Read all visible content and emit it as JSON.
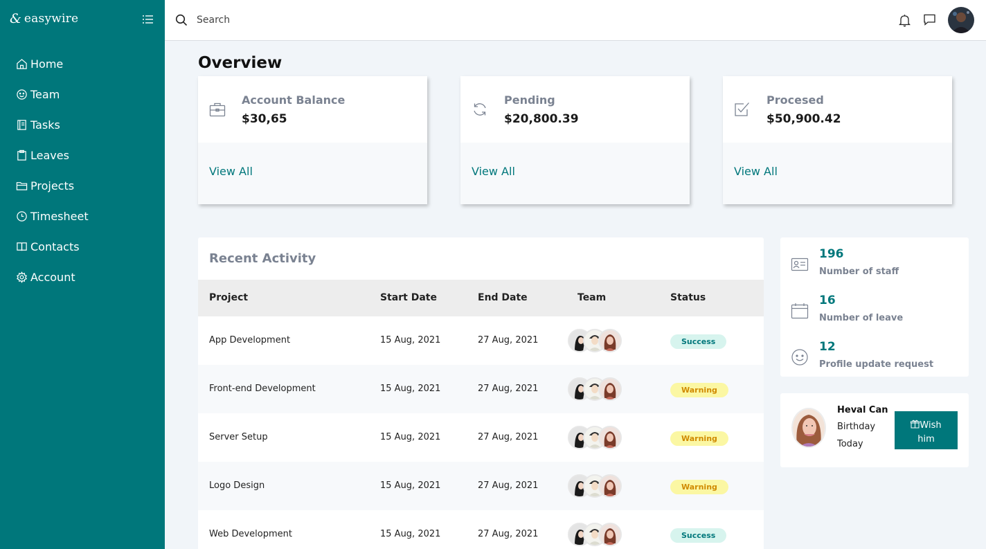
{
  "brand": {
    "mark": "&",
    "name": "easywire"
  },
  "sidebar": {
    "items": [
      {
        "label": "Home",
        "icon": "home-icon"
      },
      {
        "label": "Team",
        "icon": "smile-icon"
      },
      {
        "label": "Tasks",
        "icon": "notebook-icon"
      },
      {
        "label": "Leaves",
        "icon": "clipboard-icon"
      },
      {
        "label": "Projects",
        "icon": "folder-icon"
      },
      {
        "label": "Timesheet",
        "icon": "clock-icon"
      },
      {
        "label": "Contacts",
        "icon": "book-icon"
      },
      {
        "label": "Account",
        "icon": "gear-icon"
      }
    ]
  },
  "topbar": {
    "search_placeholder": "Search"
  },
  "overview": {
    "title": "Overview",
    "cards": [
      {
        "label": "Account Balance",
        "value": "$30,65",
        "link": "View All",
        "icon": "briefcase-icon"
      },
      {
        "label": "Pending",
        "value": "$20,800.39",
        "link": "View All",
        "icon": "refresh-icon"
      },
      {
        "label": "Procesed",
        "value": "$50,900.42",
        "link": "View All",
        "icon": "checkbox-icon"
      }
    ]
  },
  "activity": {
    "title": "Recent Activity",
    "columns": [
      "Project",
      "Start Date",
      "End Date",
      "Team",
      "Status"
    ],
    "rows": [
      {
        "project": "App Development",
        "start": "15 Aug, 2021",
        "end": "27 Aug, 2021",
        "status": "Success"
      },
      {
        "project": "Front-end Development",
        "start": "15 Aug, 2021",
        "end": "27 Aug, 2021",
        "status": "Warning"
      },
      {
        "project": "Server Setup",
        "start": "15 Aug, 2021",
        "end": "27 Aug, 2021",
        "status": "Warning"
      },
      {
        "project": "Logo Design",
        "start": "15 Aug, 2021",
        "end": "27 Aug, 2021",
        "status": "Warning"
      },
      {
        "project": "Web Development",
        "start": "15 Aug, 2021",
        "end": "27 Aug, 2021",
        "status": "Success"
      }
    ]
  },
  "stats": [
    {
      "value": "196",
      "label": "Number of staff",
      "icon": "id-card-icon"
    },
    {
      "value": "16",
      "label": "Number of leave",
      "icon": "calendar-icon"
    },
    {
      "value": "12",
      "label": "Profile update request",
      "icon": "smile-icon"
    }
  ],
  "birthday": {
    "name": "Heval Can",
    "line1": "Birthday",
    "line2": "Today",
    "button_line1": "Wish",
    "button_line2": "him",
    "button_icon": "gift-icon"
  },
  "colors": {
    "accent": "#00777b",
    "success_bg": "#d7f4ee",
    "warning_bg": "#fbf7a3",
    "warning_text": "#d08a00"
  }
}
